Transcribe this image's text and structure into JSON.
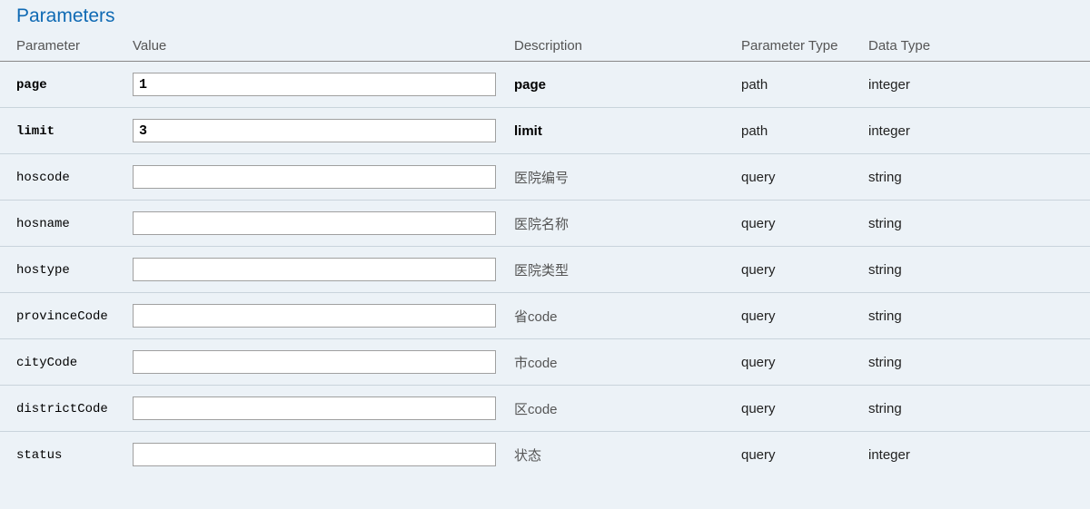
{
  "section_title": "Parameters",
  "headers": {
    "parameter": "Parameter",
    "value": "Value",
    "description": "Description",
    "parameter_type": "Parameter Type",
    "data_type": "Data Type"
  },
  "rows": [
    {
      "name": "page",
      "value": "1",
      "desc": "page",
      "ptype": "path",
      "dtype": "integer",
      "required": true
    },
    {
      "name": "limit",
      "value": "3",
      "desc": "limit",
      "ptype": "path",
      "dtype": "integer",
      "required": true
    },
    {
      "name": "hoscode",
      "value": "",
      "desc": "医院编号",
      "ptype": "query",
      "dtype": "string",
      "required": false
    },
    {
      "name": "hosname",
      "value": "",
      "desc": "医院名称",
      "ptype": "query",
      "dtype": "string",
      "required": false
    },
    {
      "name": "hostype",
      "value": "",
      "desc": "医院类型",
      "ptype": "query",
      "dtype": "string",
      "required": false
    },
    {
      "name": "provinceCode",
      "value": "",
      "desc": "省code",
      "ptype": "query",
      "dtype": "string",
      "required": false
    },
    {
      "name": "cityCode",
      "value": "",
      "desc": "市code",
      "ptype": "query",
      "dtype": "string",
      "required": false
    },
    {
      "name": "districtCode",
      "value": "",
      "desc": "区code",
      "ptype": "query",
      "dtype": "string",
      "required": false
    },
    {
      "name": "status",
      "value": "",
      "desc": "状态",
      "ptype": "query",
      "dtype": "integer",
      "required": false
    }
  ]
}
